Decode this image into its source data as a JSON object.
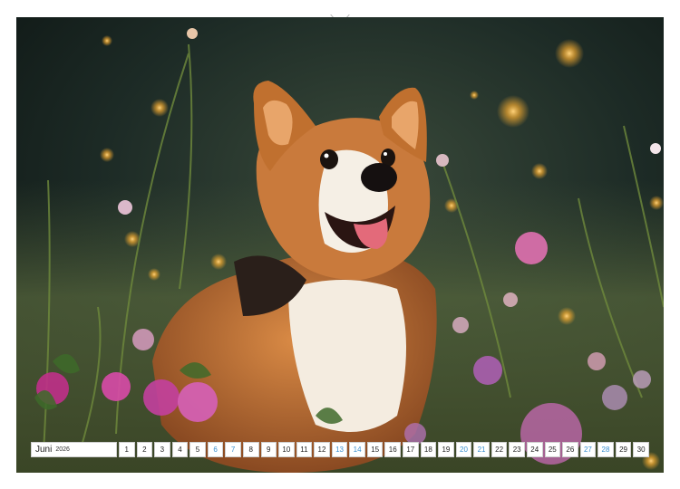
{
  "calendar": {
    "month": "Juni",
    "year": "2026",
    "days": [
      {
        "n": "1",
        "weekend": false
      },
      {
        "n": "2",
        "weekend": false
      },
      {
        "n": "3",
        "weekend": false
      },
      {
        "n": "4",
        "weekend": false
      },
      {
        "n": "5",
        "weekend": false
      },
      {
        "n": "6",
        "weekend": true
      },
      {
        "n": "7",
        "weekend": true
      },
      {
        "n": "8",
        "weekend": false
      },
      {
        "n": "9",
        "weekend": false
      },
      {
        "n": "10",
        "weekend": false
      },
      {
        "n": "11",
        "weekend": false
      },
      {
        "n": "12",
        "weekend": false
      },
      {
        "n": "13",
        "weekend": true
      },
      {
        "n": "14",
        "weekend": true
      },
      {
        "n": "15",
        "weekend": false
      },
      {
        "n": "16",
        "weekend": false
      },
      {
        "n": "17",
        "weekend": false
      },
      {
        "n": "18",
        "weekend": false
      },
      {
        "n": "19",
        "weekend": false
      },
      {
        "n": "20",
        "weekend": true
      },
      {
        "n": "21",
        "weekend": true
      },
      {
        "n": "22",
        "weekend": false
      },
      {
        "n": "23",
        "weekend": false
      },
      {
        "n": "24",
        "weekend": false
      },
      {
        "n": "25",
        "weekend": false
      },
      {
        "n": "26",
        "weekend": false
      },
      {
        "n": "27",
        "weekend": true
      },
      {
        "n": "28",
        "weekend": true
      },
      {
        "n": "29",
        "weekend": false
      },
      {
        "n": "30",
        "weekend": false
      }
    ]
  },
  "colors": {
    "weekend": "#3a8fd0",
    "weekday": "#222222"
  },
  "icons": {
    "binding": "spiral-binding-icon",
    "hanger": "hanger-hole-icon"
  }
}
